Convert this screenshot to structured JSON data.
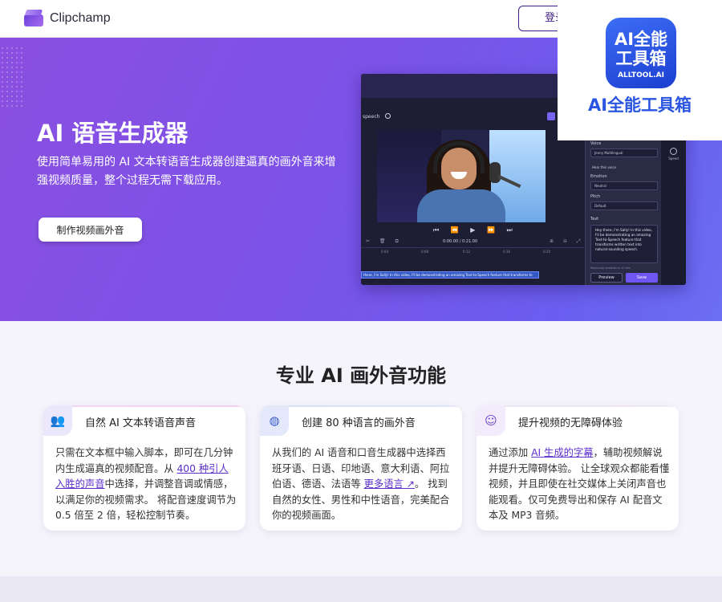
{
  "header": {
    "brand": "Clipchamp",
    "login_label": "登录"
  },
  "hero": {
    "title": "AI 语音生成器",
    "subtitle": "使用简单易用的 AI 文本转语音生成器创建逼真的画外音来增强视频质量，整个过程无需下载应用。",
    "cta_label": "制作视频画外音"
  },
  "editor": {
    "tab_label": "speech",
    "controls": "⏮ ⏪ ▶ ⏩ ⏭",
    "time": "0:00.00 / 0:21.00",
    "ruler": [
      "0:04",
      "0:08",
      "0:12",
      "0:16",
      "0:20"
    ],
    "caption": "there, I'm Sally! In this video, I'll be demonstrating an amazing Text-to-Speech feature that transforms te",
    "panel": {
      "voice_label": "Voice",
      "voice_value": "Jenny Multilingual",
      "hear_label": "Hear this voice",
      "emotion_label": "Emotion",
      "emotion_value": "Neutral",
      "pitch_label": "Pitch",
      "pitch_value": "Default",
      "text_label": "Text",
      "text_value": "Hey there, I'm Sally! In this video, I'll be demonstrating an amazing Text-to-Speech feature that transforms written text into natural-sounding speech.",
      "max_note": "Maximum duration is 10 min",
      "preview_label": "Preview",
      "save_label": "Save"
    },
    "rail": [
      {
        "label": "Text to speech"
      },
      {
        "label": "Help"
      },
      {
        "label": "Speed"
      }
    ]
  },
  "watermark": {
    "icon_line1": "AI全能",
    "icon_line2": "工具箱",
    "icon_line3": "ALLTOOL.AI",
    "text": "AI全能工具箱"
  },
  "features": {
    "title": "专业 AI 画外音功能",
    "cards": [
      {
        "icon": "users-icon",
        "title": "自然 AI 文本转语音声音",
        "body_pre": "只需在文本框中输入脚本，即可在几分钟内生成逼真的视频配音。从 ",
        "link": "400 种引人入胜的声音",
        "body_post": "中选择，并调整音调或情感，以满足你的视频需求。 将配音速度调节为 0.5 倍至 2 倍，轻松控制节奏。"
      },
      {
        "icon": "globe-icon",
        "title": "创建 80 种语言的画外音",
        "body_pre": "从我们的 AI 语音和口音生成器中选择西班牙语、日语、印地语、意大利语、阿拉伯语、德语、法语等 ",
        "link": "更多语言 ↗",
        "body_post": "。 找到自然的女性、男性和中性语音，完美配合你的视频画面。"
      },
      {
        "icon": "smile-icon",
        "title": "提升视频的无障碍体验",
        "body_pre": "通过添加 ",
        "link": "AI 生成的字幕",
        "body_post": "，辅助视频解说并提升无障碍体验。 让全球观众都能看懂视频，并且即使在社交媒体上关闭声音也能观看。仅可免费导出和保存 AI 配音文本及 MP3 音频。"
      }
    ]
  }
}
